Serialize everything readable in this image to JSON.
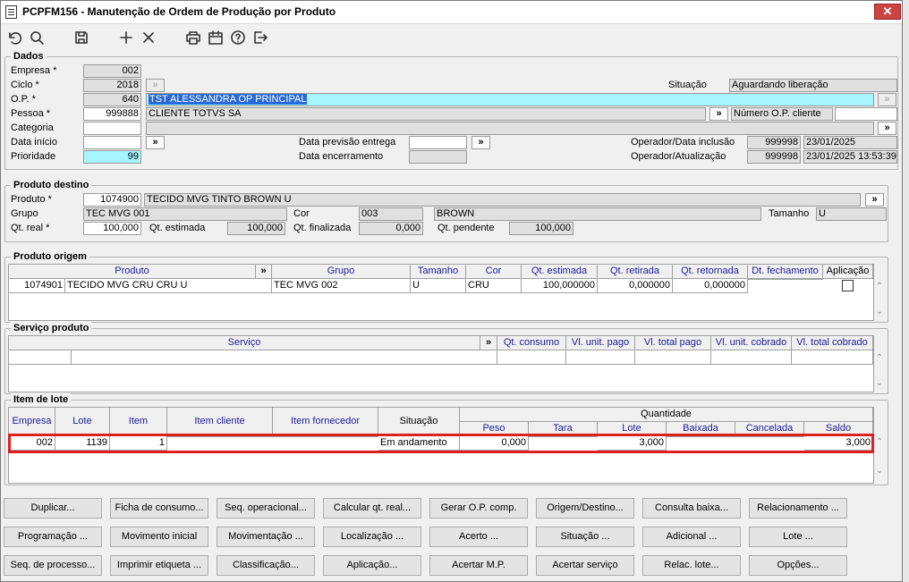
{
  "window": {
    "title": "PCPFM156 - Manutenção de Ordem de Produção por Produto",
    "close": "✕"
  },
  "toolbar": {
    "icons": [
      "undo-icon",
      "search-icon",
      "save-icon",
      "add-icon",
      "delete-icon",
      "print-icon",
      "calendar-icon",
      "help-icon",
      "exit-icon"
    ]
  },
  "dados": {
    "title": "Dados",
    "empresa_label": "Empresa *",
    "empresa": "002",
    "ciclo_label": "Ciclo *",
    "ciclo": "2018",
    "op_label": "O.P. *",
    "op": "640",
    "op_desc": "TST ALESSANDRA OP PRINCIPAL",
    "pessoa_label": "Pessoa *",
    "pessoa": "999888",
    "pessoa_desc": "CLIENTE TOTVS SA",
    "numero_op_cliente_label": "Número O.P. cliente",
    "numero_op_cliente": "",
    "categoria_label": "Categoria",
    "categoria": "",
    "data_inicio_label": "Data início",
    "data_inicio": "",
    "prioridade_label": "Prioridade",
    "prioridade": "99",
    "situacao_label": "Situação",
    "situacao": "Aguardando liberação",
    "data_prev_label": "Data previsão entrega",
    "data_prev": "",
    "data_enc_label": "Data encerramento",
    "data_enc": "",
    "op_inclusao_label": "Operador/Data inclusão",
    "op_inclusao_user": "999998",
    "op_inclusao_data": "23/01/2025",
    "op_atual_label": "Operador/Atualização",
    "op_atual_user": "999998",
    "op_atual_data": "23/01/2025 13:53:39",
    "arrow": "»"
  },
  "destino": {
    "title": "Produto destino",
    "produto_label": "Produto *",
    "produto": "1074900",
    "produto_desc": "TECIDO MVG TINTO BROWN U",
    "grupo_label": "Grupo",
    "grupo": "TEC MVG 001",
    "cor_label": "Cor",
    "cor": "003",
    "cor_desc": "BROWN",
    "tamanho_label": "Tamanho",
    "tamanho": "U",
    "qt_real_label": "Qt. real *",
    "qt_real": "100,000",
    "qt_est_label": "Qt. estimada",
    "qt_est": "100,000",
    "qt_fin_label": "Qt. finalizada",
    "qt_fin": "0,000",
    "qt_pend_label": "Qt. pendente",
    "qt_pend": "100,000"
  },
  "origem": {
    "title": "Produto origem",
    "headers": [
      "Produto",
      "»",
      "Grupo",
      "Tamanho",
      "Cor",
      "Qt. estimada",
      "Qt. retirada",
      "Qt. retornada",
      "Dt. fechamento",
      "Aplicação"
    ],
    "row": [
      "1074901",
      "TECIDO MVG CRU CRU U",
      "TEC MVG 002",
      "U",
      "CRU",
      "100,000000",
      "0,000000",
      "0,000000",
      ""
    ]
  },
  "servico": {
    "title": "Serviço produto",
    "headers": [
      "Serviço",
      "»",
      "Qt. consumo",
      "Vl. unit. pago",
      "Vl. total pago",
      "Vl. unit. cobrado",
      "Vl. total cobrado"
    ]
  },
  "lote": {
    "title": "Item de lote",
    "headers": [
      "Empresa",
      "Lote",
      "Item",
      "Item cliente",
      "Item fornecedor",
      "Situação"
    ],
    "quantidade": "Quantidade",
    "qty_headers": [
      "Peso",
      "Tara",
      "Lote",
      "Baixada",
      "Cancelada",
      "Saldo"
    ],
    "row": [
      "002",
      "1139",
      "1",
      "",
      "",
      "Em andamento",
      "0,000",
      "",
      "3,000",
      "",
      "",
      "3,000"
    ]
  },
  "buttons": [
    [
      "Duplicar...",
      "Ficha de consumo...",
      "Seq. operacional...",
      "Calcular qt. real...",
      "Gerar O.P. comp.",
      "Origem/Destino...",
      "Consulta baixa...",
      "Relacionamento ..."
    ],
    [
      "Programação ...",
      "Movimento inicial",
      "Movimentação ...",
      "Localização ...",
      "Acerto ...",
      "Situação ...",
      "Adicional ...",
      "Lote ..."
    ],
    [
      "Seq. de processo...",
      "Imprimir etiqueta ...",
      "Classificação...",
      "Aplicação...",
      "Acertar M.P.",
      "Acertar serviço",
      "Relac. lote...",
      "Opções..."
    ]
  ],
  "colors": {
    "highlight_border": "#e02020",
    "cyan_field": "#a6f5ff",
    "header_text": "#1b1b9a"
  }
}
